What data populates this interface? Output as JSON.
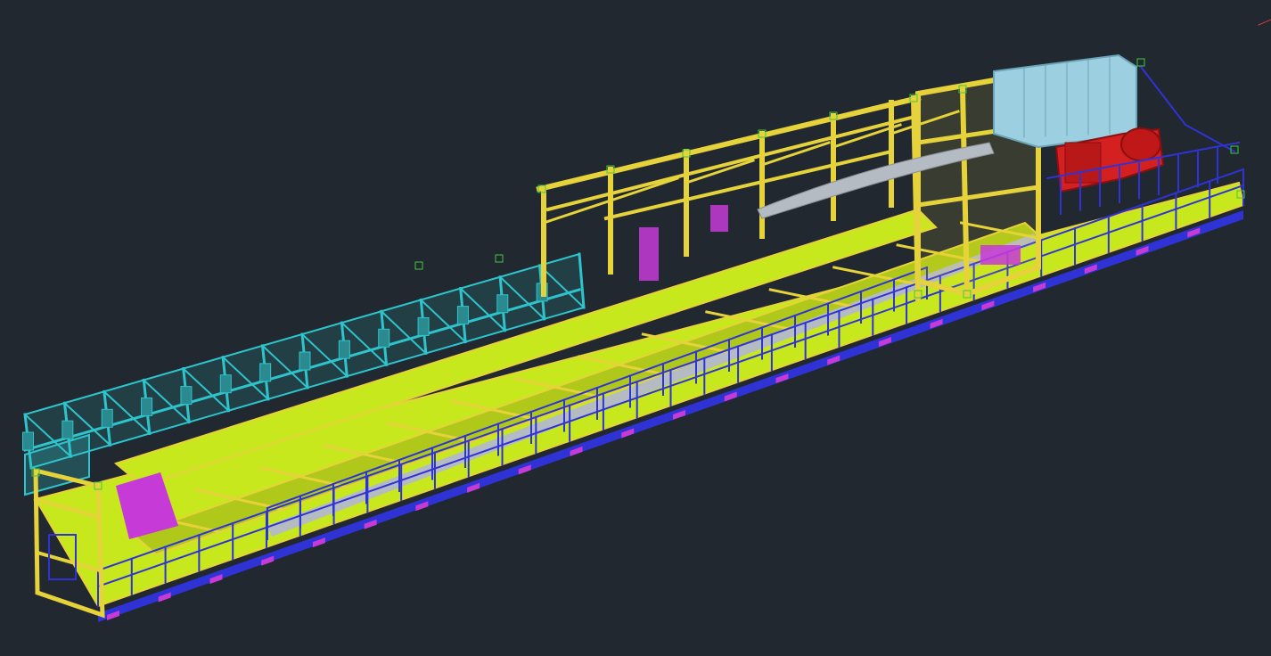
{
  "viewport": {
    "background": "#212830",
    "model_colors": {
      "structure_yellow": "#E6D23A",
      "deck_fill": "#C8E81E",
      "handrail_blue": "#2F33D6",
      "gallery_cyan": "#2EC4CC",
      "accent_magenta": "#C63AD8",
      "motor_red": "#D42020",
      "housing_lightblue": "#9CCFE0",
      "conveyor_gray": "#B5BBC2",
      "edge_green": "#40C840",
      "highlight_lime": "#D8F020"
    }
  }
}
